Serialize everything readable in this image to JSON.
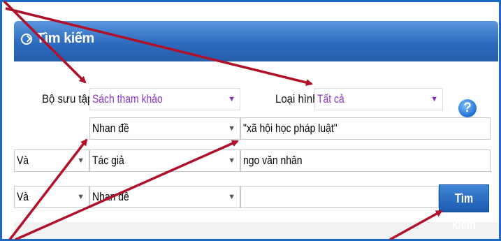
{
  "header": {
    "title": "Tìm kiếm"
  },
  "collection": {
    "label": "Bộ sưu tập:",
    "value": "Sách tham khảo"
  },
  "doc_type": {
    "label": "Loại hình:",
    "value": "Tất cả"
  },
  "help": {
    "glyph": "?"
  },
  "rows": [
    {
      "operator": "",
      "field": "Nhan đề",
      "query": "\"xã hội học pháp luật\""
    },
    {
      "operator": "Và",
      "field": "Tác giả",
      "query": "ngo văn nhân"
    },
    {
      "operator": "Và",
      "field": "Nhan đề",
      "query": ""
    }
  ],
  "search_button": {
    "label": "Tìm kiếm"
  },
  "colors": {
    "accent": "#1d68c2",
    "arrow": "#b0102a",
    "select_text": "#8a35c4"
  },
  "icons": {
    "dropdown": "triangle-down",
    "help": "question-circle",
    "header": "chevron-circle"
  }
}
